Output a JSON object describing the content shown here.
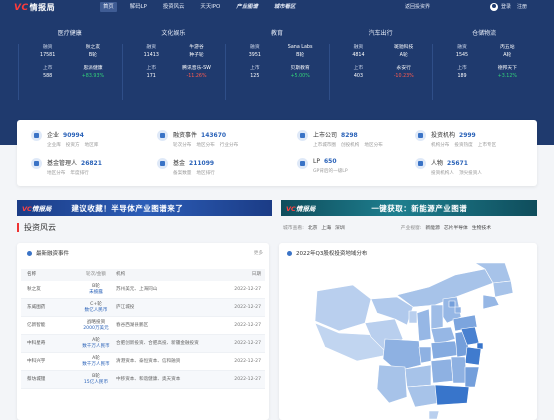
{
  "colors": {
    "hero_bg": "#1f3a6e",
    "accent_blue": "#2a62b8",
    "up": "#33d17a",
    "down": "#ff5a4e",
    "brand_red": "#ff3a3a"
  },
  "header": {
    "logo_text": "情报局",
    "nav": [
      {
        "label": "首页",
        "active": true,
        "bold": false
      },
      {
        "label": "解码LP",
        "active": false,
        "bold": false
      },
      {
        "label": "投资风云",
        "active": false,
        "bold": false
      },
      {
        "label": "天天IPO",
        "active": false,
        "bold": false
      },
      {
        "label": "产业图谱",
        "active": false,
        "bold": true
      },
      {
        "label": "城市看区",
        "active": false,
        "bold": true
      }
    ],
    "back_link": "返回投资界",
    "login": "登录",
    "register": "注册"
  },
  "sectors": [
    {
      "title": "医疗健康",
      "fin_label": "融资",
      "fin_value": "17581",
      "fin_company": "秋之友",
      "fin_round": "B轮",
      "ipo_label": "上市",
      "ipo_value": "588",
      "ipo_company": "思派健康",
      "ipo_pct": "+83.93%",
      "ipo_dir": "up"
    },
    {
      "title": "文化娱乐",
      "fin_label": "融资",
      "fin_value": "11413",
      "fin_company": "牛游谷",
      "fin_round": "种子轮",
      "ipo_label": "上市",
      "ipo_value": "171",
      "ipo_company": "腾讯音乐-SW",
      "ipo_pct": "-11.26%",
      "ipo_dir": "down"
    },
    {
      "title": "教育",
      "fin_label": "融资",
      "fin_value": "3951",
      "fin_company": "Sana Labs",
      "fin_round": "B轮",
      "ipo_label": "上市",
      "ipo_value": "125",
      "ipo_company": "贝斯教育",
      "ipo_pct": "+5.00%",
      "ipo_dir": "up"
    },
    {
      "title": "汽车出行",
      "fin_label": "融资",
      "fin_value": "4814",
      "fin_company": "斑驰科技",
      "fin_round": "A轮",
      "ipo_label": "上市",
      "ipo_value": "403",
      "ipo_company": "永安行",
      "ipo_pct": "-10.23%",
      "ipo_dir": "down"
    },
    {
      "title": "仓储物流",
      "fin_label": "融资",
      "fin_value": "1545",
      "fin_company": "丙五站",
      "fin_round": "A轮",
      "ipo_label": "上市",
      "ipo_value": "189",
      "ipo_company": "德邦天下",
      "ipo_pct": "+3.12%",
      "ipo_dir": "up"
    }
  ],
  "stats": [
    {
      "name": "企业",
      "value": "90994",
      "links": [
        "企业库",
        "投资方",
        "地区库"
      ],
      "icon": "building-icon"
    },
    {
      "name": "融资事件",
      "value": "143670",
      "links": [
        "轮次分布",
        "地区分布",
        "行业分布"
      ],
      "icon": "money-icon"
    },
    {
      "name": "上市公司",
      "value": "8298",
      "links": [
        "上市城市圈",
        "创投机构",
        "地区分布"
      ],
      "icon": "chart-icon"
    },
    {
      "name": "投资机构",
      "value": "2999",
      "links": [
        "机构分布",
        "投资热度",
        "上市专区"
      ],
      "icon": "briefcase-icon"
    },
    {
      "name": "基金管理人",
      "value": "26821",
      "links": [
        "地区分布",
        "年度排行"
      ],
      "icon": "fund-icon"
    },
    {
      "name": "基金",
      "value": "211099",
      "links": [
        "备案数量",
        "地区排行"
      ],
      "icon": "coin-icon"
    },
    {
      "name": "LP",
      "value": "650",
      "links": [
        "GP背后的一级LP"
      ],
      "icon": "lp-icon"
    },
    {
      "name": "人物",
      "value": "25671",
      "links": [
        "投资机构人",
        "顶尖投资人"
      ],
      "icon": "person-icon"
    }
  ],
  "banners": {
    "left_logo": "情报局",
    "left_text": "建议收藏！半导体产业图谱来了",
    "right_logo": "情报局",
    "right_text": "一键获取：新能源产业图谱"
  },
  "section": {
    "title": "投资风云",
    "city_label": "城市查看:",
    "cities": [
      "北京",
      "上海",
      "深圳"
    ],
    "industry_label": "产业视窗:",
    "industries": [
      "新能源",
      "芯片半导体",
      "生物技术"
    ]
  },
  "events_panel": {
    "title": "最新融资事件",
    "more": "更多",
    "columns": [
      "名称",
      "轮次/金额",
      "机构",
      "日期"
    ],
    "rows": [
      {
        "name": "秋之友",
        "round": "B轮",
        "amount": "未披露",
        "investors": "苏州美元、上海同山",
        "date": "2022-12-27"
      },
      {
        "name": "东威图药",
        "round": "C+轮",
        "amount": "数亿人民币",
        "investors": "庐江城投",
        "date": "2022-12-27"
      },
      {
        "name": "亿新智能",
        "round": "战略投资",
        "amount": "2000万美元",
        "investors": "春谷西湖县鹏区",
        "date": "2022-12-27"
      },
      {
        "name": "中科星奇",
        "round": "A轮",
        "amount": "数千万人民币",
        "investors": "合肥创新投资、合肥高投、新疆金融投资",
        "date": "2022-12-27"
      },
      {
        "name": "中科兴宇",
        "round": "A轮",
        "amount": "数千万人民币",
        "investors": "清港资本、泰恒资本、信和融资",
        "date": "2022-12-27"
      },
      {
        "name": "蔡坊城锂",
        "round": "B轮",
        "amount": "15亿人民币",
        "investors": "中移资本、和谐健康、奥天资本",
        "date": "2022-12-27"
      }
    ]
  },
  "map_panel": {
    "title": "2022年Q3股权投资地域分布",
    "scale": {
      "low": "#dbe7f7",
      "mid": "#8fb2e2",
      "high": "#2f6fc9"
    },
    "intensity": {
      "新疆": 0.2,
      "西藏": 0.15,
      "青海": 0.2,
      "内蒙古": 0.3,
      "甘肃": 0.25,
      "黑龙江": 0.3,
      "吉林": 0.3,
      "辽宁": 0.4,
      "四川": 0.45,
      "云南": 0.3,
      "陕西": 0.4,
      "山西": 0.35,
      "河北": 0.4,
      "北京": 0.6,
      "山东": 0.55,
      "河南": 0.4,
      "湖北": 0.5,
      "湖南": 0.45,
      "贵州": 0.3,
      "广西": 0.3,
      "江西": 0.45,
      "安徽": 0.6,
      "江苏": 0.85,
      "上海": 0.95,
      "浙江": 0.9,
      "福建": 0.6,
      "广东": 0.95,
      "海南": 0.2,
      "宁夏": 0.2,
      "重庆": 0.45,
      "天津": 0.45
    }
  }
}
